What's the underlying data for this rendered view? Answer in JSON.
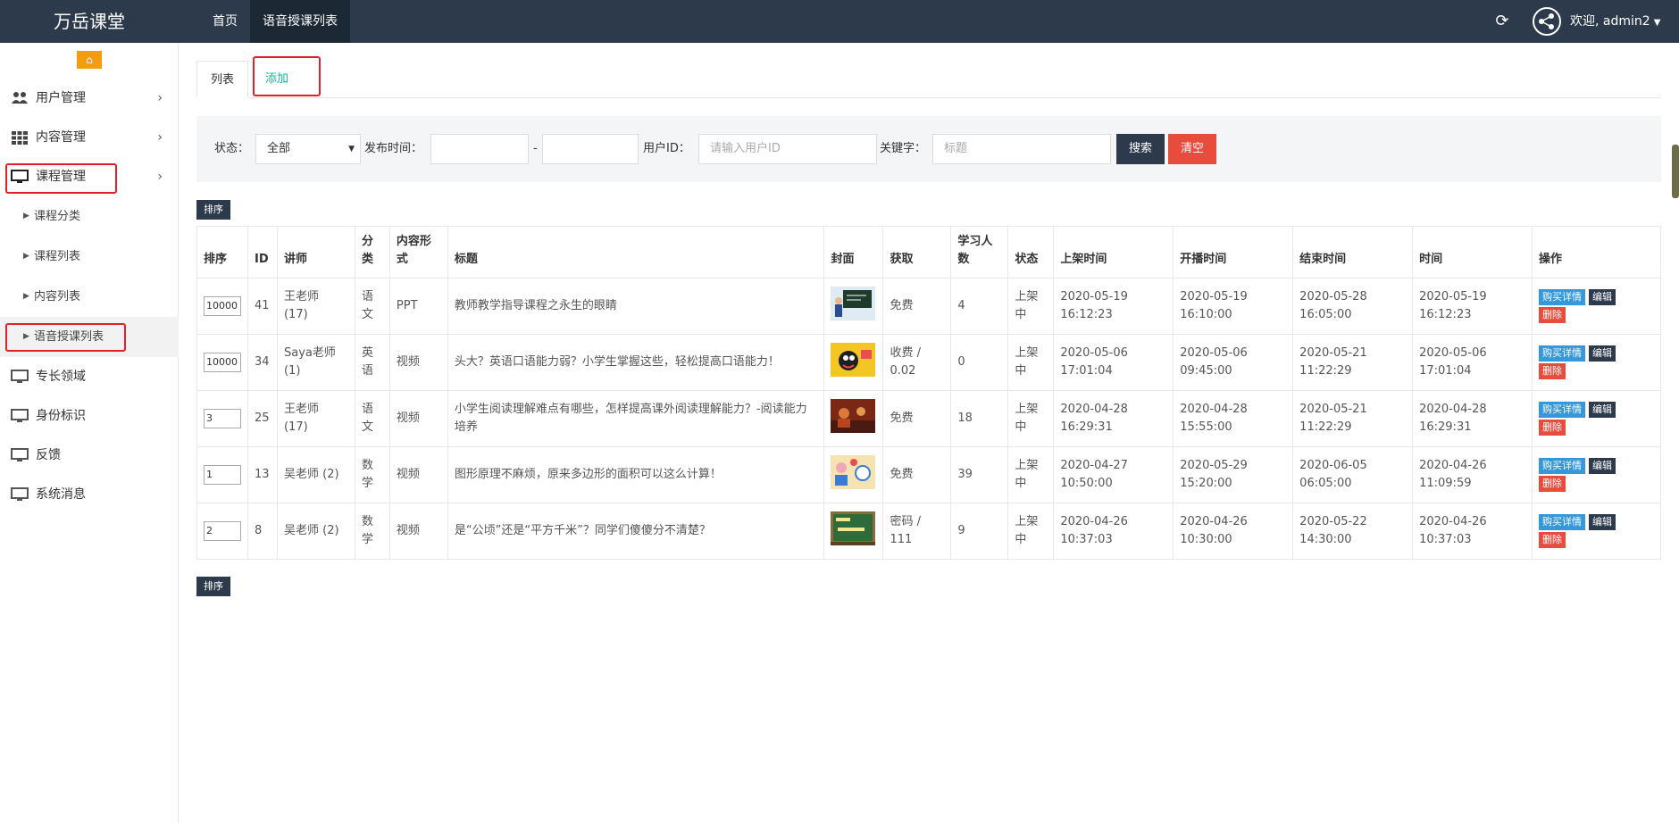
{
  "header": {
    "brand": "万岳课堂",
    "nav": [
      {
        "label": "首页"
      },
      {
        "label": "语音授课列表"
      }
    ],
    "welcome": "欢迎, admin2"
  },
  "sidebar": {
    "home_icon": "home-icon",
    "items": [
      {
        "label": "用户管理",
        "icon": "users-icon"
      },
      {
        "label": "内容管理",
        "icon": "grid-icon"
      },
      {
        "label": "课程管理",
        "icon": "monitor-icon"
      }
    ],
    "sub_items": [
      {
        "label": "课程分类"
      },
      {
        "label": "课程列表"
      },
      {
        "label": "内容列表"
      },
      {
        "label": "语音授课列表"
      }
    ],
    "items_after": [
      {
        "label": "专长领域",
        "icon": "monitor-icon"
      },
      {
        "label": "身份标识",
        "icon": "monitor-icon"
      },
      {
        "label": "反馈",
        "icon": "monitor-icon"
      },
      {
        "label": "系统消息",
        "icon": "monitor-icon"
      }
    ]
  },
  "tabs": [
    {
      "label": "列表"
    },
    {
      "label": "添加"
    }
  ],
  "filter": {
    "status_label": "状态：",
    "status_value": "全部",
    "publish_label": "发布时间：",
    "dash": "-",
    "userid_label": "用户ID：",
    "userid_placeholder": "请输入用户ID",
    "keyword_label": "关键字：",
    "keyword_placeholder": "标题",
    "search_label": "搜索",
    "clear_label": "清空"
  },
  "sort_button": "排序",
  "table": {
    "headers": [
      "排序",
      "ID",
      "讲师",
      "分类",
      "内容形式",
      "标题",
      "封面",
      "获取",
      "学习人数",
      "状态",
      "上架时间",
      "开播时间",
      "结束时间",
      "时间",
      "操作"
    ],
    "header_lines": [
      [
        "排序"
      ],
      [
        "ID"
      ],
      [
        "讲师"
      ],
      [
        "分",
        "类"
      ],
      [
        "内容形",
        "式"
      ],
      [
        "标题"
      ],
      [
        "封面"
      ],
      [
        "获取"
      ],
      [
        "学习人",
        "数"
      ],
      [
        "状态"
      ],
      [
        "上架时间"
      ],
      [
        "开播时间"
      ],
      [
        "结束时间"
      ],
      [
        "时间"
      ],
      [
        "操作"
      ]
    ],
    "rows": [
      {
        "sort": "10000",
        "id": "41",
        "teacher": [
          "王老师",
          "(17)"
        ],
        "category": [
          "语",
          "文"
        ],
        "form": "PPT",
        "title": "教师教学指导课程之永生的眼睛",
        "cover": "teacher-blackboard",
        "access": [
          "免费"
        ],
        "learners": "4",
        "status": [
          "上架",
          "中"
        ],
        "listed": [
          "2020-05-19",
          "16:12:23"
        ],
        "start": [
          "2020-05-19",
          "16:10:00"
        ],
        "end": [
          "2020-05-28",
          "16:05:00"
        ],
        "time": [
          "2020-05-19",
          "16:12:23"
        ]
      },
      {
        "sort": "10000",
        "id": "34",
        "teacher": [
          "Saya老师",
          "(1)"
        ],
        "category": [
          "英",
          "语"
        ],
        "form": "视频",
        "title": "头大？英语口语能力弱？小学生掌握这些，轻松提高口语能力！",
        "cover": "yellow-cartoon",
        "access": [
          "收费 /",
          "0.02"
        ],
        "learners": "0",
        "status": [
          "上架",
          "中"
        ],
        "listed": [
          "2020-05-06",
          "17:01:04"
        ],
        "start": [
          "2020-05-06",
          "09:45:00"
        ],
        "end": [
          "2020-05-21",
          "11:22:29"
        ],
        "time": [
          "2020-05-06",
          "17:01:04"
        ]
      },
      {
        "sort": "3",
        "id": "25",
        "teacher": [
          "王老师",
          "(17)"
        ],
        "category": [
          "语",
          "文"
        ],
        "form": "视频",
        "title": "小学生阅读理解难点有哪些，怎样提高课外阅读理解能力？-阅读能力培养",
        "cover": "red-scene",
        "access": [
          "免费"
        ],
        "learners": "18",
        "status": [
          "上架",
          "中"
        ],
        "listed": [
          "2020-04-28",
          "16:29:31"
        ],
        "start": [
          "2020-04-28",
          "15:55:00"
        ],
        "end": [
          "2020-05-21",
          "11:22:29"
        ],
        "time": [
          "2020-04-28",
          "16:29:31"
        ]
      },
      {
        "sort": "1",
        "id": "13",
        "teacher": [
          "吴老师 (2)"
        ],
        "category": [
          "数",
          "学"
        ],
        "form": "视频",
        "title": "图形原理不麻烦，原来多边形的面积可以这么计算！",
        "cover": "kids-cartoon",
        "access": [
          "免费"
        ],
        "learners": "39",
        "status": [
          "上架",
          "中"
        ],
        "listed": [
          "2020-04-27",
          "10:50:00"
        ],
        "start": [
          "2020-05-29",
          "15:20:00"
        ],
        "end": [
          "2020-06-05",
          "06:05:00"
        ],
        "time": [
          "2020-04-26",
          "11:09:59"
        ]
      },
      {
        "sort": "2",
        "id": "8",
        "teacher": [
          "吴老师 (2)"
        ],
        "category": [
          "数",
          "学"
        ],
        "form": "视频",
        "title": "是“公顷”还是“平方千米”？同学们傻傻分不清楚？",
        "cover": "green-board",
        "access": [
          "密码 /",
          "111"
        ],
        "learners": "9",
        "status": [
          "上架",
          "中"
        ],
        "listed": [
          "2020-04-26",
          "10:37:03"
        ],
        "start": [
          "2020-04-26",
          "10:30:00"
        ],
        "end": [
          "2020-05-22",
          "14:30:00"
        ],
        "time": [
          "2020-04-26",
          "10:37:03"
        ]
      }
    ],
    "ops": {
      "detail": "购买详情",
      "edit": "编辑",
      "delete": "删除"
    }
  },
  "colors": {
    "topbar": "#2c3a4b",
    "accent_green": "#1ab394",
    "danger": "#e74c3c",
    "info": "#3498db",
    "warning": "#f39c12",
    "highlight": "#e0202a"
  }
}
